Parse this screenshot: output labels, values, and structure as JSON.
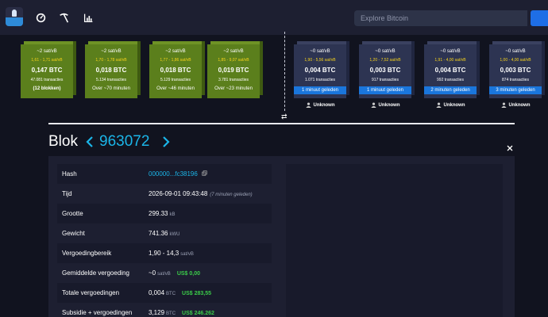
{
  "nav": {
    "search_placeholder": "Explore Bitcoin"
  },
  "colors": {
    "background": "#11131f",
    "topbar": "#1d1f31",
    "mined_block": "#5b7f1c",
    "pending_block": "#2d3452",
    "accent_blue": "#1a76dc",
    "link": "#1bb5e8",
    "fiat_green": "#3bcc49",
    "fee_range_yellow": "#f8d41b"
  },
  "icons": [
    "mempool-logo-icon",
    "dashboard-gauge-icon",
    "mining-pickaxe-icon",
    "graphs-icon",
    "search-icon",
    "swap-arrows-icon",
    "copy-icon",
    "close-icon",
    "chevron-left-icon",
    "chevron-right-icon",
    "miner-user-icon"
  ],
  "mempool_blocks": [
    {
      "fee": "~2 sat/vB",
      "range": "1,61 - 1,71 sat/vB",
      "btc": "0,147 BTC",
      "tx": "47.081 transacties",
      "bottom": "(12 blokken)"
    },
    {
      "fee": "~2 sat/vB",
      "range": "1,70 - 1,78 sat/vB",
      "btc": "0,018 BTC",
      "tx": "5.134 transacties",
      "bottom": "Over ~70 minuten"
    },
    {
      "fee": "~2 sat/vB",
      "range": "1,77 - 1,86 sat/vB",
      "btc": "0,018 BTC",
      "tx": "5.129 transacties",
      "bottom": "Over ~46 minuten"
    },
    {
      "fee": "~2 sat/vB",
      "range": "1,85 - 9,07 sat/vB",
      "btc": "0,019 BTC",
      "tx": "3.781 transacties",
      "bottom": "Over ~23 minuten"
    }
  ],
  "mined_blocks": [
    {
      "fee": "~0 sat/vB",
      "range": "1,90 - 5,56 sat/vB",
      "btc": "0,004 BTC",
      "tx": "1.071 transacties",
      "ago": "1 minuut geleden",
      "miner": "Unknown"
    },
    {
      "fee": "~0 sat/vB",
      "range": "1,20 - 7,52 sat/vB",
      "btc": "0,003 BTC",
      "tx": "917 transacties",
      "ago": "1 minuut geleden",
      "miner": "Unknown"
    },
    {
      "fee": "~0 sat/vB",
      "range": "1,91 - 4,00 sat/vB",
      "btc": "0,004 BTC",
      "tx": "992 transacties",
      "ago": "2 minuten geleden",
      "miner": "Unknown"
    },
    {
      "fee": "~0 sat/vB",
      "range": "1,00 - 4,00 sat/vB",
      "btc": "0,003 BTC",
      "tx": "874 transacties",
      "ago": "3 minuten geleden",
      "miner": "Unknown"
    }
  ],
  "block": {
    "title": "Blok",
    "height": "963072",
    "rows": {
      "hash": {
        "label": "Hash",
        "value": "000000...fc38196"
      },
      "time": {
        "label": "Tijd",
        "value": "2026-09-01 09:43:48",
        "ago": "(7 minuten geleden)"
      },
      "size": {
        "label": "Grootte",
        "value": "299.33",
        "unit": "kB"
      },
      "weight": {
        "label": "Gewicht",
        "value": "741.36",
        "unit": "kWU"
      },
      "fee_range": {
        "label": "Vergoedingbereik",
        "value": "1,90 - 14,3",
        "unit": "sat/vB"
      },
      "avg_fee": {
        "label": "Gemiddelde vergoeding",
        "value": "~0",
        "unit": "sat/vB",
        "fiat": "US$ 0,00"
      },
      "total_fees": {
        "label": "Totale vergoedingen",
        "value": "0,004",
        "unit": "BTC",
        "fiat": "US$ 283,55"
      },
      "subsidy": {
        "label": "Subsidie + vergoedingen",
        "value": "3,129",
        "unit": "BTC",
        "fiat": "US$ 246.262"
      }
    }
  }
}
